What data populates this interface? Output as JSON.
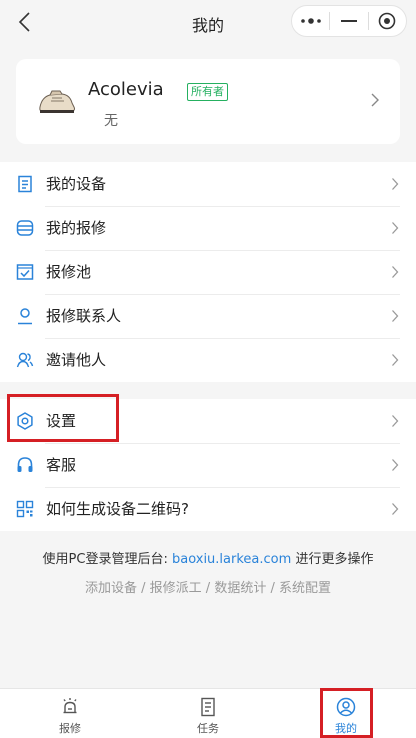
{
  "header": {
    "title": "我的",
    "back_icon": "chevron-left-icon",
    "capsule_icons": [
      "more-dots-icon",
      "minimize-icon",
      "close-target-icon"
    ]
  },
  "profile": {
    "name": "Acolevia",
    "badge": "所有者",
    "subtitle": "无",
    "avatar_icon": "shoe-avatar-icon"
  },
  "menu_group_1": [
    {
      "label": "我的设备",
      "icon": "device-list-icon"
    },
    {
      "label": "我的报修",
      "icon": "repair-stack-icon"
    },
    {
      "label": "报修池",
      "icon": "checkbox-icon"
    },
    {
      "label": "报修联系人",
      "icon": "person-icon"
    },
    {
      "label": "邀请他人",
      "icon": "invite-people-icon"
    }
  ],
  "menu_group_2": [
    {
      "label": "设置",
      "icon": "settings-gear-icon"
    },
    {
      "label": "客服",
      "icon": "headset-icon"
    },
    {
      "label": "如何生成设备二维码?",
      "icon": "qrcode-icon"
    }
  ],
  "footer": {
    "prefix": "使用PC登录管理后台:",
    "link": "baoxiu.larkea.com",
    "suffix": " 进行更多操作",
    "sub": "添加设备 / 报修派工 / 数据统计 / 系统配置"
  },
  "tabs": [
    {
      "label": "报修",
      "icon": "repair-bell-icon",
      "active": false
    },
    {
      "label": "任务",
      "icon": "task-doc-icon",
      "active": false
    },
    {
      "label": "我的",
      "icon": "user-circle-icon",
      "active": true
    }
  ],
  "colors": {
    "accent": "#2a83d9",
    "badge_green": "#25b060",
    "highlight_red": "#d51f24",
    "background": "#f5f5f5"
  }
}
